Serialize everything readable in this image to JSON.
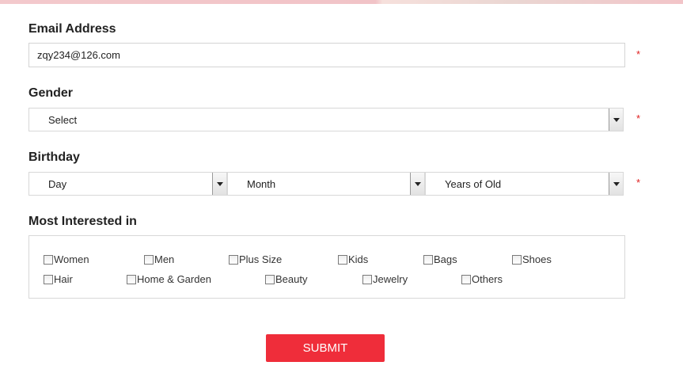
{
  "email": {
    "label": "Email Address",
    "value": "zqy234@126.com",
    "required_mark": "*"
  },
  "gender": {
    "label": "Gender",
    "selected": "Select",
    "required_mark": "*"
  },
  "birthday": {
    "label": "Birthday",
    "day": "Day",
    "month": "Month",
    "years": "Years of Old",
    "required_mark": "*"
  },
  "interests": {
    "label": "Most Interested in",
    "options": [
      "Women",
      "Men",
      "Plus Size",
      "Kids",
      "Bags",
      "Shoes",
      "Hair",
      "Home & Garden",
      "Beauty",
      "Jewelry",
      "Others"
    ]
  },
  "submit_label": "SUBMIT",
  "colors": {
    "accent": "#ef2d3a",
    "required": "#e02020"
  }
}
